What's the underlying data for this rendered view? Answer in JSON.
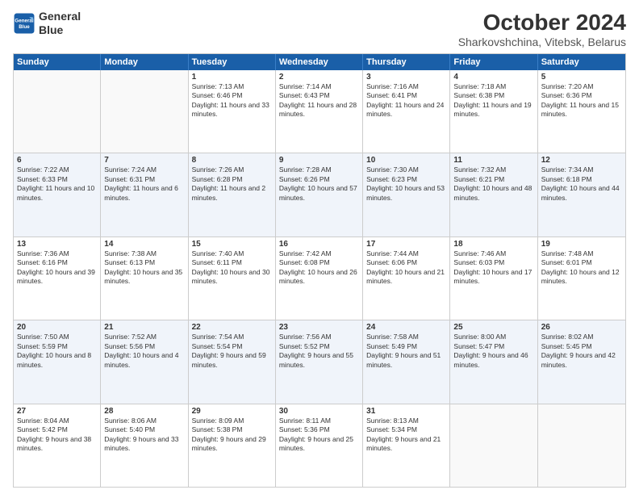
{
  "logo": {
    "line1": "General",
    "line2": "Blue"
  },
  "title": "October 2024",
  "subtitle": "Sharkovshchina, Vitebsk, Belarus",
  "headers": [
    "Sunday",
    "Monday",
    "Tuesday",
    "Wednesday",
    "Thursday",
    "Friday",
    "Saturday"
  ],
  "rows": [
    {
      "alt": false,
      "cells": [
        {
          "num": "",
          "sunrise": "",
          "sunset": "",
          "daylight": ""
        },
        {
          "num": "",
          "sunrise": "",
          "sunset": "",
          "daylight": ""
        },
        {
          "num": "1",
          "sunrise": "Sunrise: 7:13 AM",
          "sunset": "Sunset: 6:46 PM",
          "daylight": "Daylight: 11 hours and 33 minutes."
        },
        {
          "num": "2",
          "sunrise": "Sunrise: 7:14 AM",
          "sunset": "Sunset: 6:43 PM",
          "daylight": "Daylight: 11 hours and 28 minutes."
        },
        {
          "num": "3",
          "sunrise": "Sunrise: 7:16 AM",
          "sunset": "Sunset: 6:41 PM",
          "daylight": "Daylight: 11 hours and 24 minutes."
        },
        {
          "num": "4",
          "sunrise": "Sunrise: 7:18 AM",
          "sunset": "Sunset: 6:38 PM",
          "daylight": "Daylight: 11 hours and 19 minutes."
        },
        {
          "num": "5",
          "sunrise": "Sunrise: 7:20 AM",
          "sunset": "Sunset: 6:36 PM",
          "daylight": "Daylight: 11 hours and 15 minutes."
        }
      ]
    },
    {
      "alt": true,
      "cells": [
        {
          "num": "6",
          "sunrise": "Sunrise: 7:22 AM",
          "sunset": "Sunset: 6:33 PM",
          "daylight": "Daylight: 11 hours and 10 minutes."
        },
        {
          "num": "7",
          "sunrise": "Sunrise: 7:24 AM",
          "sunset": "Sunset: 6:31 PM",
          "daylight": "Daylight: 11 hours and 6 minutes."
        },
        {
          "num": "8",
          "sunrise": "Sunrise: 7:26 AM",
          "sunset": "Sunset: 6:28 PM",
          "daylight": "Daylight: 11 hours and 2 minutes."
        },
        {
          "num": "9",
          "sunrise": "Sunrise: 7:28 AM",
          "sunset": "Sunset: 6:26 PM",
          "daylight": "Daylight: 10 hours and 57 minutes."
        },
        {
          "num": "10",
          "sunrise": "Sunrise: 7:30 AM",
          "sunset": "Sunset: 6:23 PM",
          "daylight": "Daylight: 10 hours and 53 minutes."
        },
        {
          "num": "11",
          "sunrise": "Sunrise: 7:32 AM",
          "sunset": "Sunset: 6:21 PM",
          "daylight": "Daylight: 10 hours and 48 minutes."
        },
        {
          "num": "12",
          "sunrise": "Sunrise: 7:34 AM",
          "sunset": "Sunset: 6:18 PM",
          "daylight": "Daylight: 10 hours and 44 minutes."
        }
      ]
    },
    {
      "alt": false,
      "cells": [
        {
          "num": "13",
          "sunrise": "Sunrise: 7:36 AM",
          "sunset": "Sunset: 6:16 PM",
          "daylight": "Daylight: 10 hours and 39 minutes."
        },
        {
          "num": "14",
          "sunrise": "Sunrise: 7:38 AM",
          "sunset": "Sunset: 6:13 PM",
          "daylight": "Daylight: 10 hours and 35 minutes."
        },
        {
          "num": "15",
          "sunrise": "Sunrise: 7:40 AM",
          "sunset": "Sunset: 6:11 PM",
          "daylight": "Daylight: 10 hours and 30 minutes."
        },
        {
          "num": "16",
          "sunrise": "Sunrise: 7:42 AM",
          "sunset": "Sunset: 6:08 PM",
          "daylight": "Daylight: 10 hours and 26 minutes."
        },
        {
          "num": "17",
          "sunrise": "Sunrise: 7:44 AM",
          "sunset": "Sunset: 6:06 PM",
          "daylight": "Daylight: 10 hours and 21 minutes."
        },
        {
          "num": "18",
          "sunrise": "Sunrise: 7:46 AM",
          "sunset": "Sunset: 6:03 PM",
          "daylight": "Daylight: 10 hours and 17 minutes."
        },
        {
          "num": "19",
          "sunrise": "Sunrise: 7:48 AM",
          "sunset": "Sunset: 6:01 PM",
          "daylight": "Daylight: 10 hours and 12 minutes."
        }
      ]
    },
    {
      "alt": true,
      "cells": [
        {
          "num": "20",
          "sunrise": "Sunrise: 7:50 AM",
          "sunset": "Sunset: 5:59 PM",
          "daylight": "Daylight: 10 hours and 8 minutes."
        },
        {
          "num": "21",
          "sunrise": "Sunrise: 7:52 AM",
          "sunset": "Sunset: 5:56 PM",
          "daylight": "Daylight: 10 hours and 4 minutes."
        },
        {
          "num": "22",
          "sunrise": "Sunrise: 7:54 AM",
          "sunset": "Sunset: 5:54 PM",
          "daylight": "Daylight: 9 hours and 59 minutes."
        },
        {
          "num": "23",
          "sunrise": "Sunrise: 7:56 AM",
          "sunset": "Sunset: 5:52 PM",
          "daylight": "Daylight: 9 hours and 55 minutes."
        },
        {
          "num": "24",
          "sunrise": "Sunrise: 7:58 AM",
          "sunset": "Sunset: 5:49 PM",
          "daylight": "Daylight: 9 hours and 51 minutes."
        },
        {
          "num": "25",
          "sunrise": "Sunrise: 8:00 AM",
          "sunset": "Sunset: 5:47 PM",
          "daylight": "Daylight: 9 hours and 46 minutes."
        },
        {
          "num": "26",
          "sunrise": "Sunrise: 8:02 AM",
          "sunset": "Sunset: 5:45 PM",
          "daylight": "Daylight: 9 hours and 42 minutes."
        }
      ]
    },
    {
      "alt": false,
      "cells": [
        {
          "num": "27",
          "sunrise": "Sunrise: 8:04 AM",
          "sunset": "Sunset: 5:42 PM",
          "daylight": "Daylight: 9 hours and 38 minutes."
        },
        {
          "num": "28",
          "sunrise": "Sunrise: 8:06 AM",
          "sunset": "Sunset: 5:40 PM",
          "daylight": "Daylight: 9 hours and 33 minutes."
        },
        {
          "num": "29",
          "sunrise": "Sunrise: 8:09 AM",
          "sunset": "Sunset: 5:38 PM",
          "daylight": "Daylight: 9 hours and 29 minutes."
        },
        {
          "num": "30",
          "sunrise": "Sunrise: 8:11 AM",
          "sunset": "Sunset: 5:36 PM",
          "daylight": "Daylight: 9 hours and 25 minutes."
        },
        {
          "num": "31",
          "sunrise": "Sunrise: 8:13 AM",
          "sunset": "Sunset: 5:34 PM",
          "daylight": "Daylight: 9 hours and 21 minutes."
        },
        {
          "num": "",
          "sunrise": "",
          "sunset": "",
          "daylight": ""
        },
        {
          "num": "",
          "sunrise": "",
          "sunset": "",
          "daylight": ""
        }
      ]
    }
  ]
}
